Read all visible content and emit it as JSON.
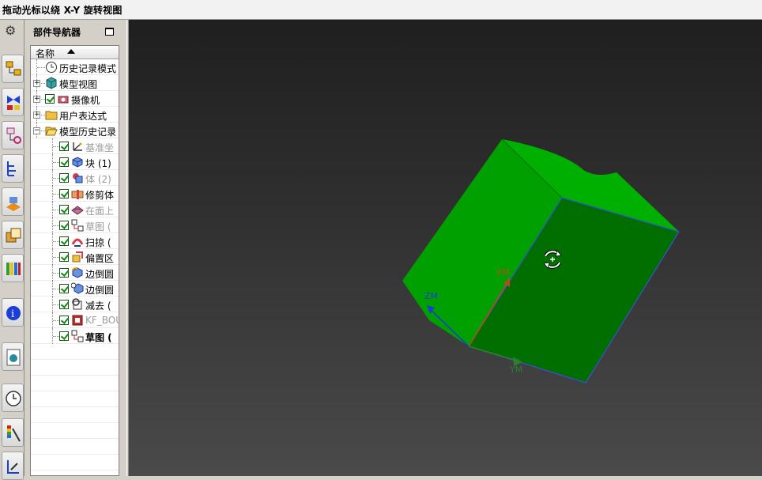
{
  "status_bar": {
    "text": "拖动光标以绕 X-Y 旋转视图"
  },
  "resource_bar": {
    "items": [
      {
        "icon": "gear-icon"
      },
      {
        "icon": "assembly-navigator-icon"
      },
      {
        "icon": "constraint-navigator-icon"
      },
      {
        "icon": "part-navigator-icon"
      },
      {
        "icon": "reuse-library-icon"
      },
      {
        "icon": "hd3d-tools-icon"
      },
      {
        "icon": "web-browser-icon"
      },
      {
        "icon": "history-icon"
      },
      {
        "icon": "system-materials-icon"
      },
      {
        "icon": "process-studio-icon"
      },
      {
        "icon": "roles-icon"
      },
      {
        "icon": "system-scenes-icon"
      }
    ]
  },
  "navigator": {
    "title": "部件导航器",
    "column_header": "名称",
    "items": [
      {
        "label": "历史记录模式",
        "icon": "history-clock-icon",
        "level": 0,
        "expander": "",
        "checked": false,
        "style": "normal"
      },
      {
        "label": "模型视图",
        "icon": "model-views-icon",
        "level": 0,
        "expander": "+",
        "checked": false,
        "style": "normal"
      },
      {
        "label": "摄像机",
        "icon": "camera-icon",
        "level": 0,
        "expander": "+",
        "checked": true,
        "style": "normal"
      },
      {
        "label": "用户表达式",
        "icon": "folder-icon",
        "level": 0,
        "expander": "+",
        "checked": false,
        "style": "normal"
      },
      {
        "label": "模型历史记录",
        "icon": "folder-open-icon",
        "level": 0,
        "expander": "−",
        "checked": false,
        "style": "normal"
      },
      {
        "label": "基准坐",
        "icon": "datum-csys-icon",
        "level": 1,
        "expander": "",
        "checked": true,
        "style": "dim"
      },
      {
        "label": "块 (1)",
        "icon": "block-icon",
        "level": 1,
        "expander": "",
        "checked": true,
        "style": "normal"
      },
      {
        "label": "体 (2)",
        "icon": "body-icon",
        "level": 1,
        "expander": "",
        "checked": true,
        "style": "dim"
      },
      {
        "label": "修剪体",
        "icon": "trim-body-icon",
        "level": 1,
        "expander": "",
        "checked": true,
        "style": "normal"
      },
      {
        "label": "在面上",
        "icon": "curve-on-face-icon",
        "level": 1,
        "expander": "",
        "checked": true,
        "style": "dim"
      },
      {
        "label": "草图 (",
        "icon": "sketch-icon",
        "level": 1,
        "expander": "",
        "checked": true,
        "style": "dim"
      },
      {
        "label": "扫掠 (",
        "icon": "sweep-icon",
        "level": 1,
        "expander": "",
        "checked": true,
        "style": "normal"
      },
      {
        "label": "偏置区",
        "icon": "offset-region-icon",
        "level": 1,
        "expander": "",
        "checked": true,
        "style": "normal"
      },
      {
        "label": "边倒圆",
        "icon": "edge-blend-icon",
        "level": 1,
        "expander": "",
        "checked": true,
        "style": "normal"
      },
      {
        "label": "边倒圆",
        "icon": "edge-blend-info-icon",
        "level": 1,
        "expander": "",
        "checked": true,
        "style": "normal"
      },
      {
        "label": "减去 (",
        "icon": "subtract-icon",
        "level": 1,
        "expander": "",
        "checked": true,
        "style": "normal"
      },
      {
        "label": "KF_BOU",
        "icon": "kf-boundary-icon",
        "level": 1,
        "expander": "",
        "checked": true,
        "style": "dim"
      },
      {
        "label": "草图 (",
        "icon": "sketch-icon",
        "level": 1,
        "expander": "",
        "checked": true,
        "style": "bold"
      }
    ]
  },
  "viewport": {
    "background_top": "#1f1f1f",
    "background_bottom": "#4a4a4a",
    "solid_color": "#00a800",
    "selected_face_color": "#006f00",
    "axis_labels": {
      "x": "XM",
      "y": "YM",
      "z": "ZM"
    },
    "axis_colors": {
      "x": "#b24e1e",
      "y": "#2f7d2f",
      "z": "#1c3fd0"
    },
    "cursor": "rotate-cursor-icon"
  }
}
